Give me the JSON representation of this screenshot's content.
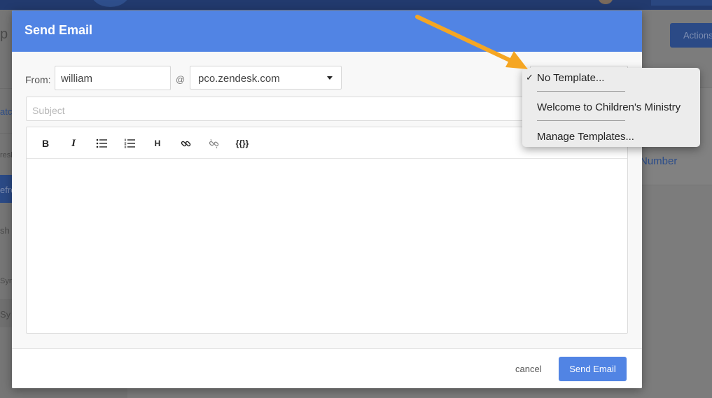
{
  "background": {
    "actions_label": "Actions",
    "number_label": "Number",
    "sidebar_fragments": [
      "p",
      "atc",
      "resh",
      "efre",
      "sh",
      "Syn",
      "Sy"
    ]
  },
  "modal": {
    "title": "Send Email",
    "from_label": "From:",
    "from_value": "william",
    "at_sign": "@",
    "domain_value": "pco.zendesk.com",
    "subject_placeholder": "Subject",
    "toolbar": {
      "bold": "B",
      "italic": "I",
      "bulleted_list": "bulleted-list-icon",
      "numbered_list": "numbered-list-icon",
      "heading": "H",
      "link": "link-icon",
      "unlink": "unlink-icon",
      "placeholder": "{{}}"
    },
    "cancel_label": "cancel",
    "send_label": "Send Email"
  },
  "template_menu": {
    "items": [
      {
        "label": "No Template...",
        "checked": true
      },
      {
        "label": "Welcome to Children's Ministry",
        "checked": false
      },
      {
        "label": "Manage Templates...",
        "checked": false
      }
    ],
    "check_glyph": "✓"
  },
  "colors": {
    "header_blue": "#5184e4",
    "send_button": "#5184e4",
    "arrow_orange": "#f5a623"
  }
}
